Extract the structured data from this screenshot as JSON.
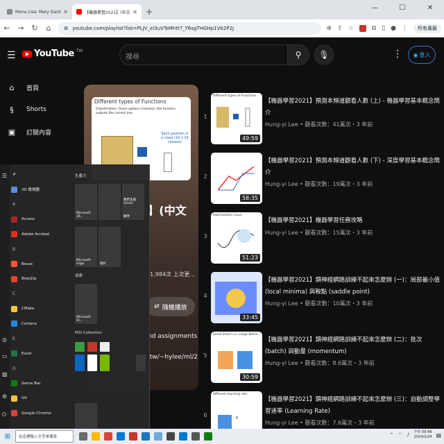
{
  "browser": {
    "tabs": [
      {
        "title": "Mona Lisa: Mary Gardiner H",
        "active": false,
        "color": "#8a8a8a"
      },
      {
        "title": "【機器學習2021】(中文版) - Y",
        "active": true,
        "color": "#ff0000"
      }
    ],
    "url": "youtube.com/playlist?list=PLJV_el3uVTsMhtt7_Y6sgTHGHp1Vb2P2J",
    "bookmarks_label": "所有書籤"
  },
  "youtube": {
    "logo_text": "YouTube",
    "region": "TW",
    "search_placeholder": "搜尋",
    "login_label": "登入",
    "sidebar": [
      {
        "icon": "home-icon",
        "label": "首頁"
      },
      {
        "icon": "shorts-icon",
        "label": "Shorts"
      },
      {
        "icon": "subscriptions-icon",
        "label": "訂閱內容"
      }
    ],
    "playlist": {
      "thumb_heading": "Different types of Functions",
      "thumb_text": "Classification: Given options (classes), the function outputs the correct one.",
      "thumb_right": "Each position is a class (19 x 19 classes)",
      "thumb_next": "a position on the board",
      "thumb_footer": "Next move",
      "title_fragment": "21】(中文",
      "stats_fragment": "31,984次 上次更...",
      "shuffle_label": "隨機播放",
      "desc_1": "nd assignments",
      "desc_2": ".tw/~hylee/ml/202"
    },
    "videos": [
      {
        "num": "1",
        "title": "【機器學習2021】預測本頻道觀看人數 (上) - 機器學習基本概念簡介",
        "channel": "Hung-yi Lee",
        "meta": "觀看次數：41萬次・3 年前",
        "duration": "49:59",
        "thumb_title": "Different types of Functions"
      },
      {
        "num": "2",
        "title": "【機器學習2021】預測本頻道觀看人數 (下) - 深度學習基本概念簡介",
        "channel": "Hung-yi Lee",
        "meta": "觀看次數：19萬次・3 年前",
        "duration": "58:35",
        "thumb_title": ""
      },
      {
        "num": "3",
        "title": "【機器學習2021】機器學習任務攻略",
        "channel": "Hung-yi Lee",
        "meta": "觀看次數：15萬次・3 年前",
        "duration": "51:23",
        "thumb_title": "Optimization Issue"
      },
      {
        "num": "4",
        "title": "【機器學習2021】類神經網路訓練不起來怎麼辦 (一)：局部最小值 (local minima) 與鞍點 (saddle point)",
        "channel": "Hung-yi Lee",
        "meta": "觀看次數：10萬次・3 年前",
        "duration": "33:45",
        "thumb_title": ""
      },
      {
        "num": "5",
        "title": "【機器學習2021】類神經網路訓練不起來怎麼辦 (二)：批次 (batch) 與動量 (momentum)",
        "channel": "Hung-yi Lee",
        "meta": "觀看次數：8.6萬次・3 年前",
        "duration": "30:59",
        "thumb_title": "Small Batch v.s. Large Batch"
      },
      {
        "num": "6",
        "title": "【機器學習2021】類神經網路訓練不起來怎麼辦 (三)：自動調整學習速率 (Learning Rate)",
        "channel": "Hung-yi Lee",
        "meta": "觀看次數：7.6萬次・3 年前",
        "duration": "",
        "thumb_title": "different learning rate"
      }
    ]
  },
  "start_menu": {
    "apps": [
      {
        "label": "#",
        "letter": true,
        "color": ""
      },
      {
        "label": "3D 檢視器",
        "letter": false,
        "color": "#5b8dd9"
      },
      {
        "label": "A",
        "letter": true,
        "color": ""
      },
      {
        "label": "Access",
        "letter": false,
        "color": "#a4262c"
      },
      {
        "label": "Adobe Acrobat",
        "letter": false,
        "color": "#e0301e"
      },
      {
        "label": "B",
        "letter": true,
        "color": ""
      },
      {
        "label": "Brave",
        "letter": false,
        "color": "#fb542b"
      },
      {
        "label": "BreeZip",
        "letter": false,
        "color": "#e2462c"
      },
      {
        "label": "C",
        "letter": true,
        "color": ""
      },
      {
        "label": "CMake",
        "letter": false,
        "color": "#f4c542"
      },
      {
        "label": "Cortana",
        "letter": false,
        "color": "#2b88d8"
      },
      {
        "label": "E",
        "letter": true,
        "color": ""
      },
      {
        "label": "Excel",
        "letter": false,
        "color": "#217346"
      },
      {
        "label": "G",
        "letter": true,
        "color": ""
      },
      {
        "label": "Game Bar",
        "letter": false,
        "color": "#107c10"
      },
      {
        "label": "Git",
        "letter": false,
        "color": "#f4c542"
      },
      {
        "label": "Google Chrome",
        "letter": false,
        "color": "#db4437"
      }
    ],
    "section_productivity": "生產力",
    "section_explore": "探索",
    "section_msi": "MSI Collection",
    "tile_m365": "Microsoft 36...",
    "tile_gmail": "我們支援 Gmail",
    "tile_mail": "郵件",
    "tile_edge": "Microsoft Edge",
    "tile_photos": "相片",
    "tile_store": "Microsoft St..."
  },
  "taskbar": {
    "search_placeholder": "在這裡輸入文字來搜尋",
    "time": "下午 09:48",
    "date": "2024/1/24"
  }
}
